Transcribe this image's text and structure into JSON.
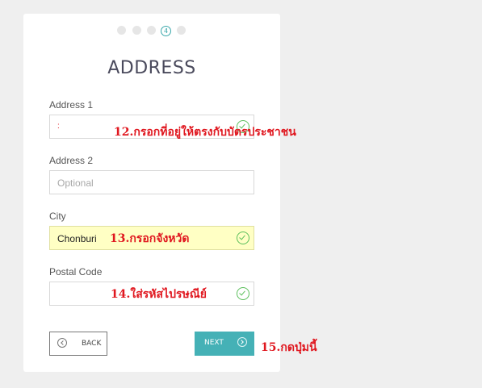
{
  "steps": {
    "active_label": "4"
  },
  "title": "ADDRESS",
  "fields": [
    {
      "label": "Address 1",
      "value": ":",
      "placeholder": ""
    },
    {
      "label": "Address 2",
      "value": "",
      "placeholder": "Optional"
    },
    {
      "label": "City",
      "value": "Chonburi",
      "placeholder": ""
    },
    {
      "label": "Postal Code",
      "value": "",
      "placeholder": ""
    }
  ],
  "annotations": {
    "a12": "12.กรอกที่อยู่ให้ตรงกับบัตรประชาชน",
    "a13": "13.กรอกจังหวัด",
    "a14": "14.ใส่รหัสไปรษณีย์",
    "a15": "15.กดปุ่มนี้"
  },
  "buttons": {
    "back": "BACK",
    "next": "NEXT"
  },
  "colors": {
    "accent": "#45b1b6",
    "valid": "#5bbf5b",
    "annotation": "#e0171f",
    "autofill": "#ffffc4"
  }
}
